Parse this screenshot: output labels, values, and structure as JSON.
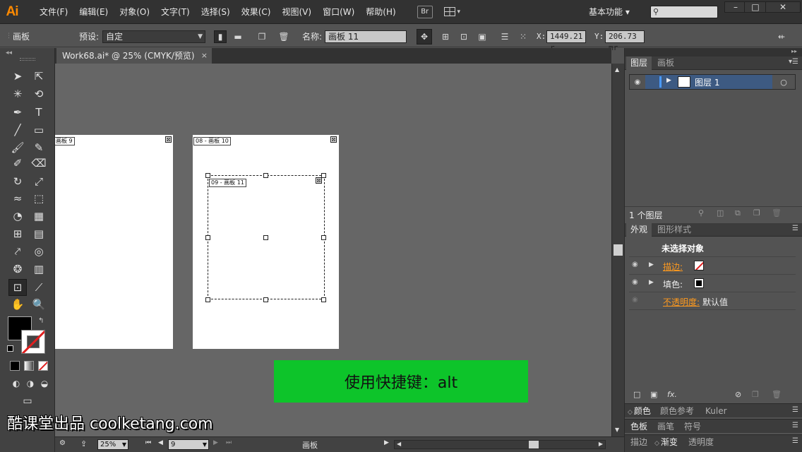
{
  "app": {
    "logo": "Ai",
    "menu": [
      "文件(F)",
      "编辑(E)",
      "对象(O)",
      "文字(T)",
      "选择(S)",
      "效果(C)",
      "视图(V)",
      "窗口(W)",
      "帮助(H)"
    ],
    "bridge_button": "Br",
    "workspace": "基本功能"
  },
  "control_bar": {
    "mode_label": "画板",
    "preset_label": "预设:",
    "preset_value": "自定",
    "name_label": "名称:",
    "name_value": "画板 11",
    "x_label": "X:",
    "x_value": "1449.21 r",
    "y_label": "Y:",
    "y_value": "206.73 mr"
  },
  "document": {
    "tab_title": "Work68.ai* @ 25% (CMYK/预览)",
    "close": "×"
  },
  "canvas": {
    "artboards": [
      {
        "label": "画板 9",
        "close": "⊠"
      },
      {
        "label": "08 - 画板 10",
        "close": "⊠"
      },
      {
        "label": "09 - 画板 11",
        "close": "⊠"
      }
    ],
    "hint": "使用快捷键：alt"
  },
  "status_bar": {
    "zoom": "25%",
    "artboard_number": "9",
    "status_text": "画板"
  },
  "watermark": "酷课堂出品 coolketang.com",
  "layers_panel": {
    "tabs": [
      "图层",
      "画板"
    ],
    "layer_name": "图层 1",
    "layer_count": "1 个图层"
  },
  "appearance_panel": {
    "tabs": [
      "外观",
      "图形样式"
    ],
    "title": "未选择对象",
    "rows": [
      {
        "label": "描边:"
      },
      {
        "label": "填色:"
      },
      {
        "label": "不透明度:",
        "value": "默认值"
      }
    ]
  },
  "bottom_tabs": {
    "row1": [
      "颜色",
      "颜色参考",
      "Kuler"
    ],
    "row2": [
      "色板",
      "画笔",
      "符号"
    ],
    "row3": [
      "描边",
      "渐变",
      "透明度"
    ]
  },
  "colors": {
    "accent_orange": "#ff8a00",
    "hint_green": "#0dc42a",
    "layer_select_blue": "#3d5a82"
  }
}
